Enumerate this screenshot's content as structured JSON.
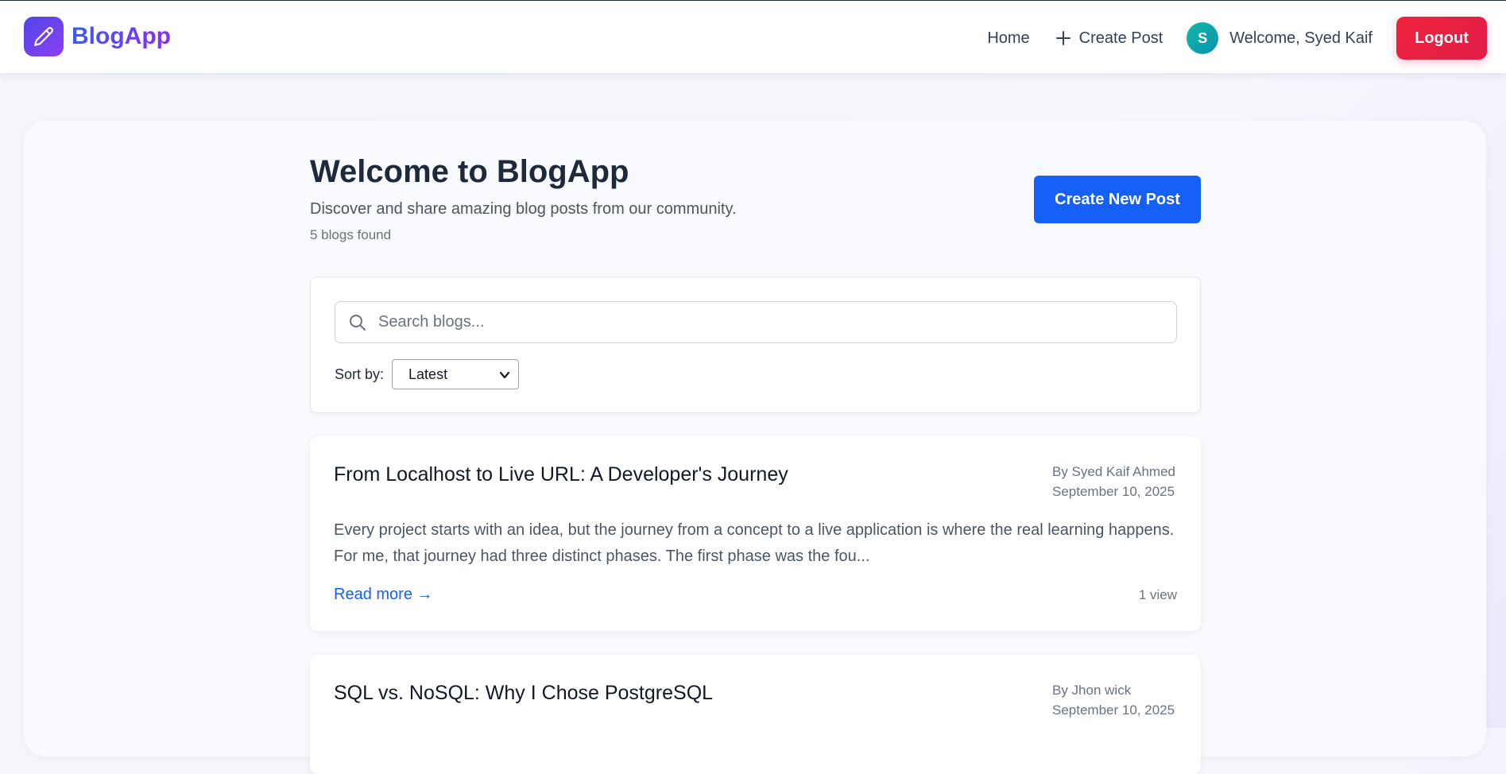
{
  "navbar": {
    "brand_name": "BlogApp",
    "home_label": "Home",
    "create_post_label": "Create Post",
    "avatar_initial": "S",
    "welcome_text": "Welcome, Syed Kaif",
    "logout_label": "Logout"
  },
  "header": {
    "title": "Welcome to BlogApp",
    "subtitle": "Discover and share amazing blog posts from our community.",
    "count_text": "5 blogs found",
    "create_new_label": "Create New Post"
  },
  "search": {
    "placeholder": "Search blogs...",
    "sort_label": "Sort by:",
    "sort_value": "Latest"
  },
  "blogs": [
    {
      "title": "From Localhost to Live URL: A Developer's Journey",
      "author": "By Syed Kaif Ahmed",
      "date": "September 10, 2025",
      "excerpt": "Every project starts with an idea, but the journey from a concept to a live application is where the real learning happens. For me, that journey had three distinct phases. The first phase was the fou...",
      "read_more": "Read more →",
      "views": "1 view"
    },
    {
      "title": "SQL vs. NoSQL: Why I Chose PostgreSQL",
      "author": "By Jhon wick",
      "date": "September 10, 2025"
    }
  ],
  "colors": {
    "brand_gradient_start": "#3b5bf0",
    "brand_gradient_end": "#8b2cf0",
    "primary_button": "#1560f6",
    "logout_button": "#ef233c",
    "avatar": "#14b8a6"
  },
  "icons": {
    "brand": "pencil-icon",
    "create_post": "plus-icon",
    "search": "search-icon",
    "sort": "chevron-down-icon"
  }
}
